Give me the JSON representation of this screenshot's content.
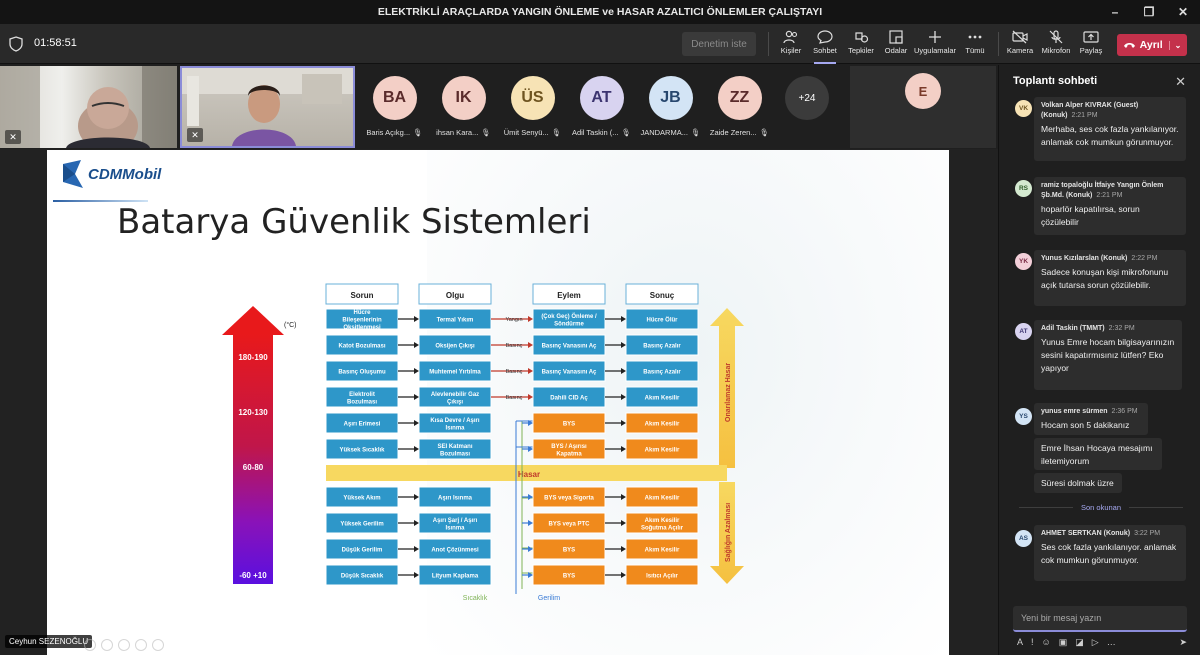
{
  "window": {
    "title": "ELEKTRİKLİ ARAÇLARDA YANGIN ÖNLEME ve HASAR AZALTICI ÖNLEMLER ÇALIŞTAYI",
    "controls": [
      "–",
      "❐",
      "✕"
    ]
  },
  "toolbar": {
    "timer": "01:58:51",
    "stop_label": "Denetim iste",
    "buttons": [
      {
        "key": "people",
        "label": "Kişiler"
      },
      {
        "key": "chat",
        "label": "Sohbet"
      },
      {
        "key": "reactions",
        "label": "Tepkiler"
      },
      {
        "key": "rooms",
        "label": "Odalar"
      },
      {
        "key": "apps",
        "label": "Uygulamalar"
      },
      {
        "key": "more",
        "label": "Tümü"
      },
      {
        "key": "camera",
        "label": "Kamera"
      },
      {
        "key": "mic",
        "label": "Mikrofon"
      },
      {
        "key": "share",
        "label": "Paylaş"
      }
    ],
    "leave_label": "Ayrıl"
  },
  "gallery": {
    "participants": [
      {
        "initials": "BA",
        "name": "Baris Açıkg...",
        "color": "#f3cfc6"
      },
      {
        "initials": "IK",
        "name": "ihsan Kara...",
        "color": "#f3cfc6"
      },
      {
        "initials": "ÜS",
        "name": "Ümit Senyü...",
        "color": "#f7e3b5"
      },
      {
        "initials": "AT",
        "name": "Adil Taskin (...",
        "color": "#d8d3f0"
      },
      {
        "initials": "JB",
        "name": "JANDARMA...",
        "color": "#d3e4f5"
      },
      {
        "initials": "ZZ",
        "name": "Zaide Zeren...",
        "color": "#f3cfc6"
      }
    ],
    "more_count": "+24",
    "extra_tile": {
      "initials": "E"
    }
  },
  "stage": {
    "presenter": "Ceyhun SEZENOĞLU",
    "slide": {
      "logo": "CDMMobil",
      "title": "Batarya Güvenlik Sistemleri",
      "headers": [
        "Sorun",
        "Olgu",
        "Eylem",
        "Sonuç"
      ],
      "scale_unit": "(°C)",
      "scale_labels": [
        "180-190",
        "120-130",
        "60-80",
        "-60 +10"
      ],
      "axis_top": "Onarılamaz Hasar",
      "axis_bottom": "Sağlığın Azalması",
      "hasar": "Hasar",
      "sicaklik": "Sıcaklık",
      "gerilim": "Gerilim",
      "rows_top": [
        {
          "sorun": "Hücre Bileşenlerinin Oksitlenmesi",
          "olgu": "Termal Yıkım",
          "link": "Yangın",
          "eylem": "(Çok Geç) Önleme / Söndürme",
          "sonuc": "Hücre Ölür"
        },
        {
          "sorun": "Katot Bozulması",
          "olgu": "Oksijen Çıkışı",
          "link": "Basınç",
          "eylem": "Basınç Vanasını Aç",
          "sonuc": "Basınç Azalır"
        },
        {
          "sorun": "Basınç Oluşumu",
          "olgu": "Muhtemel Yırtılma",
          "link": "Basınç",
          "eylem": "Basınç Vanasını Aç",
          "sonuc": "Basınç Azalır"
        },
        {
          "sorun": "Elektrolit Bozulması",
          "olgu": "Alevlenebilir Gaz Çıkışı",
          "link": "Basınç",
          "eylem": "Dahili CID Aç",
          "sonuc": "Akım Kesilir"
        },
        {
          "sorun": "Aşırı Erimesi",
          "olgu": "Kısa Devre / Aşırı Isınma",
          "link": "",
          "eylem": "BYS",
          "sonuc": "Akım Kesilir"
        },
        {
          "sorun": "Yüksek Sıcaklık",
          "olgu": "SEI Katmanı Bozulması",
          "link": "",
          "eylem": "BYS / Aşırısı Kapatma",
          "sonuc": "Akım Kesilir"
        }
      ],
      "rows_bottom": [
        {
          "sorun": "Yüksek Akım",
          "olgu": "Aşırı Isınma",
          "eylem": "BYS veya Sigorta",
          "sonuc": "Akım Kesilir"
        },
        {
          "sorun": "Yüksek Gerilim",
          "olgu": "Aşırı Şarj / Aşırı Isınma",
          "eylem": "BYS veya PTC",
          "sonuc": "Akım Kesilir Soğutma Açılır"
        },
        {
          "sorun": "Düşük Gerilim",
          "olgu": "Anot Çözünmesi",
          "eylem": "BYS",
          "sonuc": "Akım Kesilir"
        },
        {
          "sorun": "Düşük Sıcaklık",
          "olgu": "Lityum Kaplama",
          "eylem": "BYS",
          "sonuc": "Isıtıcı Açılır"
        }
      ]
    }
  },
  "chat": {
    "title": "Toplantı sohbeti",
    "messages": [
      {
        "initials": "VK",
        "color": "#f7e3b5",
        "author": "Volkan Alper KIVRAK (Guest) (Konuk)",
        "time": "2:21 PM",
        "text": "Merhaba, ses cok fazla yankılanıyor. anlamak cok mumkun görunmuyor."
      },
      {
        "initials": "RS",
        "color": "#d4e9d0",
        "author": "ramiz topaloğlu İtfaiye Yangın Önlem Şb.Md. (Konuk)",
        "time": "2:21 PM",
        "text": "hoparlör kapatılırsa, sorun çözülebilir"
      },
      {
        "initials": "YK",
        "color": "#f3cfd9",
        "author": "Yunus Kızılarslan (Konuk)",
        "time": "2:22 PM",
        "text": "Sadece konuşan kişi mikrofonunu açık tutarsa sorun çözülebilir."
      },
      {
        "initials": "AT",
        "color": "#d8d3f0",
        "author": "Adil Taskin (TMMT)",
        "time": "2:32 PM",
        "text": "Yunus Emre hocam bilgisayarınızın sesini kapatırmısınız lütfen? Eko yapıyor"
      },
      {
        "initials": "YS",
        "color": "#d3e4f5",
        "author": "yunus emre sürmen",
        "time": "2:36 PM",
        "text": "Hocam son 5 dakikanız"
      }
    ],
    "followups": [
      "Emre İhsan Hocaya mesajımı iletemiyorum",
      "Süresi dolmak üzre"
    ],
    "separator": "Son okunan",
    "last": {
      "initials": "AS",
      "color": "#d3e4f5",
      "author": "AHMET SERTKAN (Konuk)",
      "time": "3:22 PM",
      "text": "Ses cok fazla yankılanıyor. anlamak cok mumkun görunmuyor."
    },
    "compose_placeholder": "Yeni bir mesaj yazın"
  }
}
